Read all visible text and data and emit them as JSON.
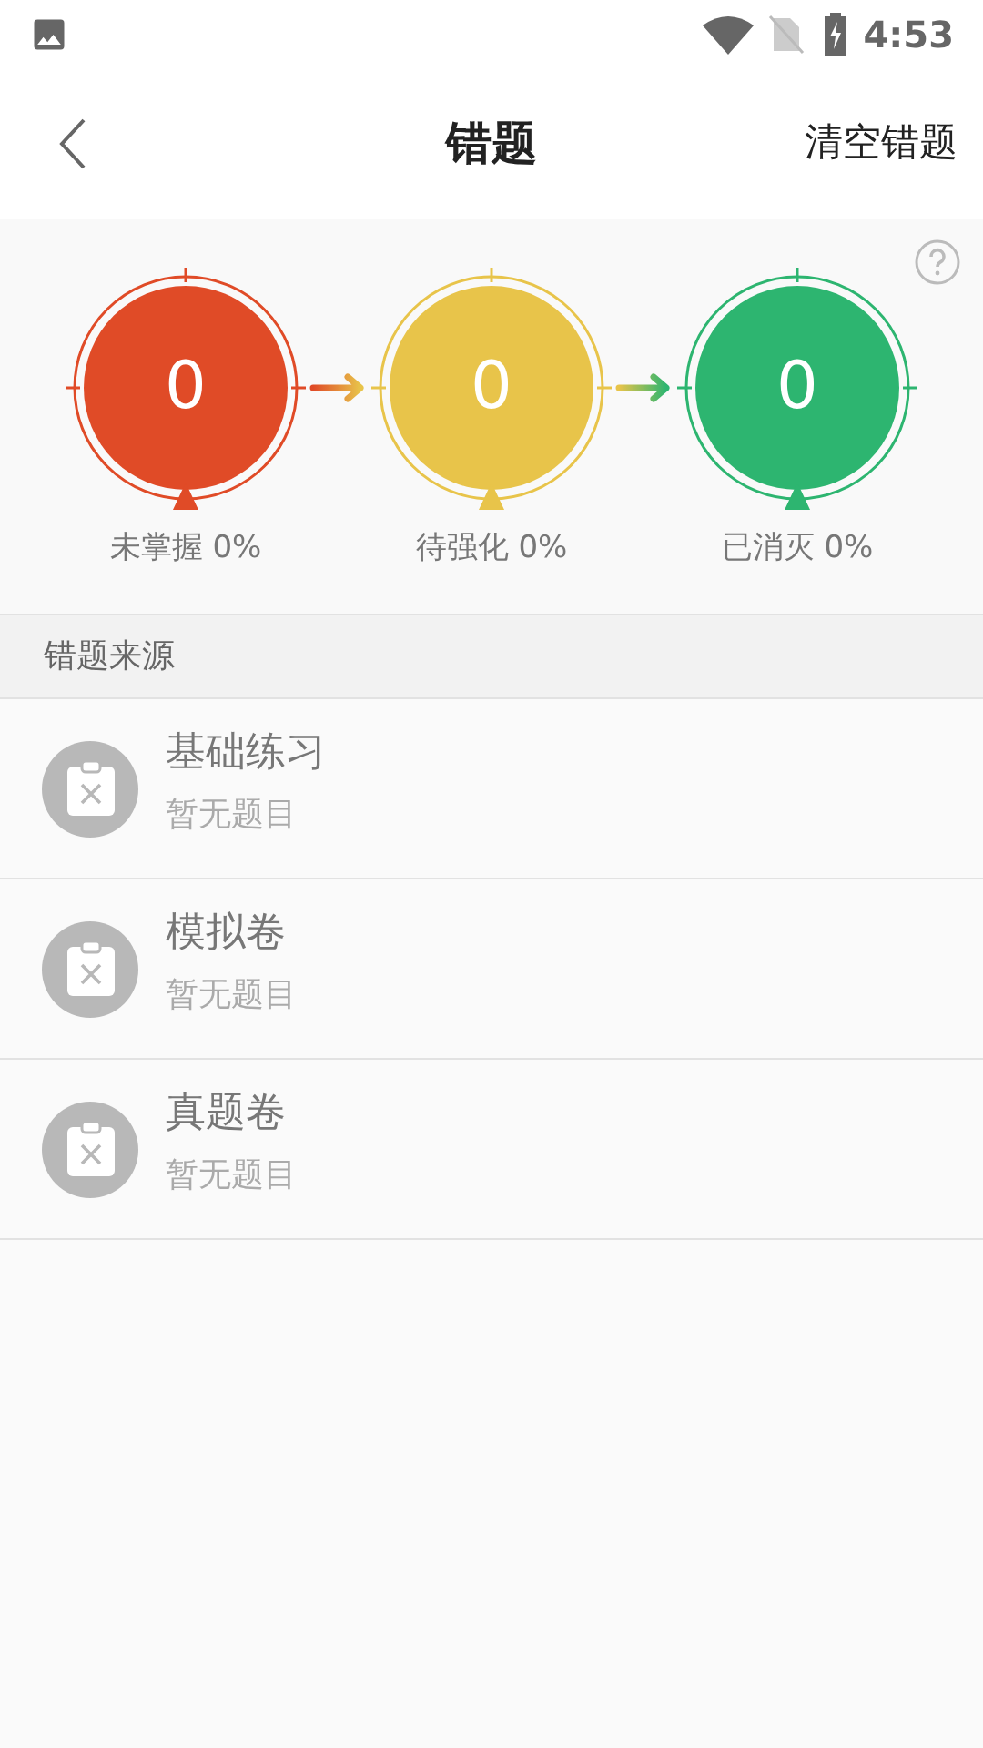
{
  "status_bar": {
    "time": "4:53"
  },
  "header": {
    "title": "错题",
    "action": "清空错题"
  },
  "stats": [
    {
      "count": "0",
      "label": "未掌握 0%",
      "color": "#e04b27"
    },
    {
      "count": "0",
      "label": "待强化 0%",
      "color": "#e8c44a"
    },
    {
      "count": "0",
      "label": "已消灭 0%",
      "color": "#2db570"
    }
  ],
  "section": {
    "title": "错题来源"
  },
  "sources": [
    {
      "title": "基础练习",
      "subtitle": "暂无题目"
    },
    {
      "title": "模拟卷",
      "subtitle": "暂无题目"
    },
    {
      "title": "真题卷",
      "subtitle": "暂无题目"
    }
  ]
}
